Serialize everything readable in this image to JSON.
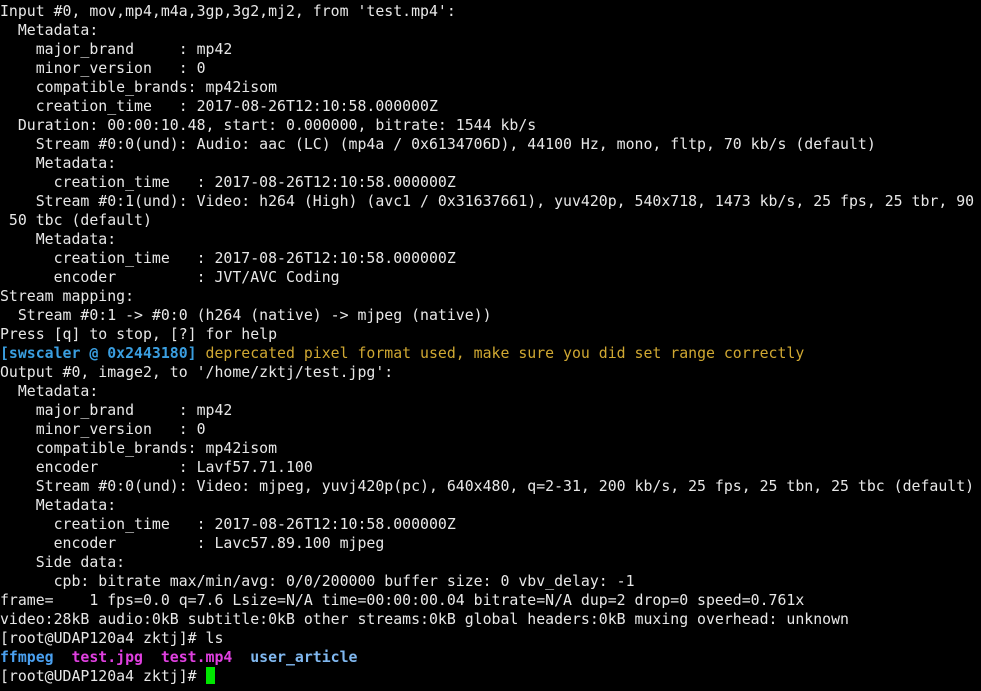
{
  "colors": {
    "background": "#000000",
    "text": "#e8e8e8",
    "swscaler_tag": "#3a9ee0",
    "warning": "#d0a832",
    "dir": "#4aa0f0",
    "image": "#e040e0",
    "dir2": "#80b8f0",
    "cursor": "#00e600"
  },
  "lines": [
    [
      {
        "t": "Input #0, mov,mp4,m4a,3gp,3g2,mj2, from 'test.mp4':"
      }
    ],
    [
      {
        "t": "  Metadata:"
      }
    ],
    [
      {
        "t": "    major_brand     : mp42"
      }
    ],
    [
      {
        "t": "    minor_version   : 0"
      }
    ],
    [
      {
        "t": "    compatible_brands: mp42isom"
      }
    ],
    [
      {
        "t": "    creation_time   : 2017-08-26T12:10:58.000000Z"
      }
    ],
    [
      {
        "t": "  Duration: 00:00:10.48, start: 0.000000, bitrate: 1544 kb/s"
      }
    ],
    [
      {
        "t": "    Stream #0:0(und): Audio: aac (LC) (mp4a / 0x6134706D), 44100 Hz, mono, fltp, 70 kb/s (default)"
      }
    ],
    [
      {
        "t": "    Metadata:"
      }
    ],
    [
      {
        "t": "      creation_time   : 2017-08-26T12:10:58.000000Z"
      }
    ],
    [
      {
        "t": "    Stream #0:1(und): Video: h264 (High) (avc1 / 0x31637661), yuv420p, 540x718, 1473 kb/s, 25 fps, 25 tbr, 90"
      }
    ],
    [
      {
        "t": " 50 tbc (default)"
      }
    ],
    [
      {
        "t": "    Metadata:"
      }
    ],
    [
      {
        "t": "      creation_time   : 2017-08-26T12:10:58.000000Z"
      }
    ],
    [
      {
        "t": "      encoder         : JVT/AVC Coding"
      }
    ],
    [
      {
        "t": "Stream mapping:"
      }
    ],
    [
      {
        "t": "  Stream #0:1 -> #0:0 (h264 (native) -> mjpeg (native))"
      }
    ],
    [
      {
        "t": "Press [q] to stop, [?] for help"
      }
    ],
    [
      {
        "t": "[swscaler @ 0x2443180]",
        "c": "swscaler_tag",
        "bold": true
      },
      {
        "t": " deprecated pixel format used, make sure you did set range correctly",
        "c": "warning"
      }
    ],
    [
      {
        "t": "Output #0, image2, to '/home/zktj/test.jpg':"
      }
    ],
    [
      {
        "t": "  Metadata:"
      }
    ],
    [
      {
        "t": "    major_brand     : mp42"
      }
    ],
    [
      {
        "t": "    minor_version   : 0"
      }
    ],
    [
      {
        "t": "    compatible_brands: mp42isom"
      }
    ],
    [
      {
        "t": "    encoder         : Lavf57.71.100"
      }
    ],
    [
      {
        "t": "    Stream #0:0(und): Video: mjpeg, yuvj420p(pc), 640x480, q=2-31, 200 kb/s, 25 fps, 25 tbn, 25 tbc (default)"
      }
    ],
    [
      {
        "t": "    Metadata:"
      }
    ],
    [
      {
        "t": "      creation_time   : 2017-08-26T12:10:58.000000Z"
      }
    ],
    [
      {
        "t": "      encoder         : Lavc57.89.100 mjpeg"
      }
    ],
    [
      {
        "t": "    Side data:"
      }
    ],
    [
      {
        "t": "      cpb: bitrate max/min/avg: 0/0/200000 buffer size: 0 vbv_delay: -1"
      }
    ],
    [
      {
        "t": "frame=    1 fps=0.0 q=7.6 Lsize=N/A time=00:00:00.04 bitrate=N/A dup=2 drop=0 speed=0.761x"
      }
    ],
    [
      {
        "t": "video:28kB audio:0kB subtitle:0kB other streams:0kB global headers:0kB muxing overhead: unknown"
      }
    ],
    [
      {
        "t": "[root@UDAP120a4 zktj]# ls"
      }
    ],
    [
      {
        "t": "ffmpeg",
        "c": "dir",
        "bold": true
      },
      {
        "t": "  "
      },
      {
        "t": "test.jpg",
        "c": "image",
        "bold": true
      },
      {
        "t": "  "
      },
      {
        "t": "test.mp4",
        "c": "image",
        "bold": true
      },
      {
        "t": "  "
      },
      {
        "t": "user_article",
        "c": "dir2",
        "bold": true
      }
    ],
    [
      {
        "t": "[root@UDAP120a4 zktj]# "
      },
      {
        "cursor": true
      }
    ]
  ]
}
